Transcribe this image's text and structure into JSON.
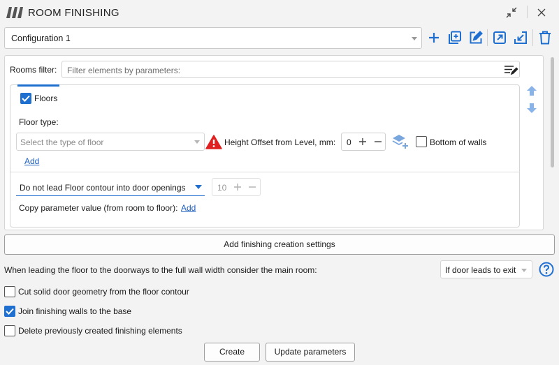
{
  "window": {
    "title": "ROOM FINISHING",
    "logo_icon": "logo-icon",
    "collapse_icon": "collapse-icon",
    "close_icon": "close-icon"
  },
  "toolbar": {
    "configuration_value": "Configuration 1",
    "icons": [
      "plus-icon",
      "duplicate-icon",
      "edit-icon",
      "export-icon",
      "import-icon",
      "delete-icon"
    ]
  },
  "rooms_filter": {
    "label": "Rooms filter:",
    "placeholder": "Filter elements by parameters:"
  },
  "floors": {
    "checkbox_label": "Floors",
    "checked": true,
    "floor_type_label": "Floor type:",
    "floor_type_placeholder": "Select the type of floor",
    "add_link": "Add",
    "height_offset_label": "Height Offset from Level, mm:",
    "height_offset_value": "0",
    "bottom_of_walls_label": "Bottom of walls",
    "bottom_of_walls_checked": false,
    "contour_option": "Do not lead Floor contour into door openings",
    "contour_value": "10",
    "copy_param_label": "Copy parameter value (from room to floor):",
    "copy_param_link": "Add"
  },
  "add_settings_button": "Add finishing creation settings",
  "main_room": {
    "label": "When leading the floor to the doorways to the full wall width consider the main room:",
    "value": "If door leads to exit"
  },
  "options": [
    {
      "label": "Cut solid door geometry from the floor contour",
      "checked": false
    },
    {
      "label": "Join finishing walls to the base",
      "checked": true
    },
    {
      "label": "Delete previously created finishing elements",
      "checked": false
    }
  ],
  "buttons": {
    "create": "Create",
    "update": "Update parameters"
  },
  "colors": {
    "accent": "#1f6fd1",
    "warning": "#e02020",
    "background": "#f3f3f3"
  }
}
